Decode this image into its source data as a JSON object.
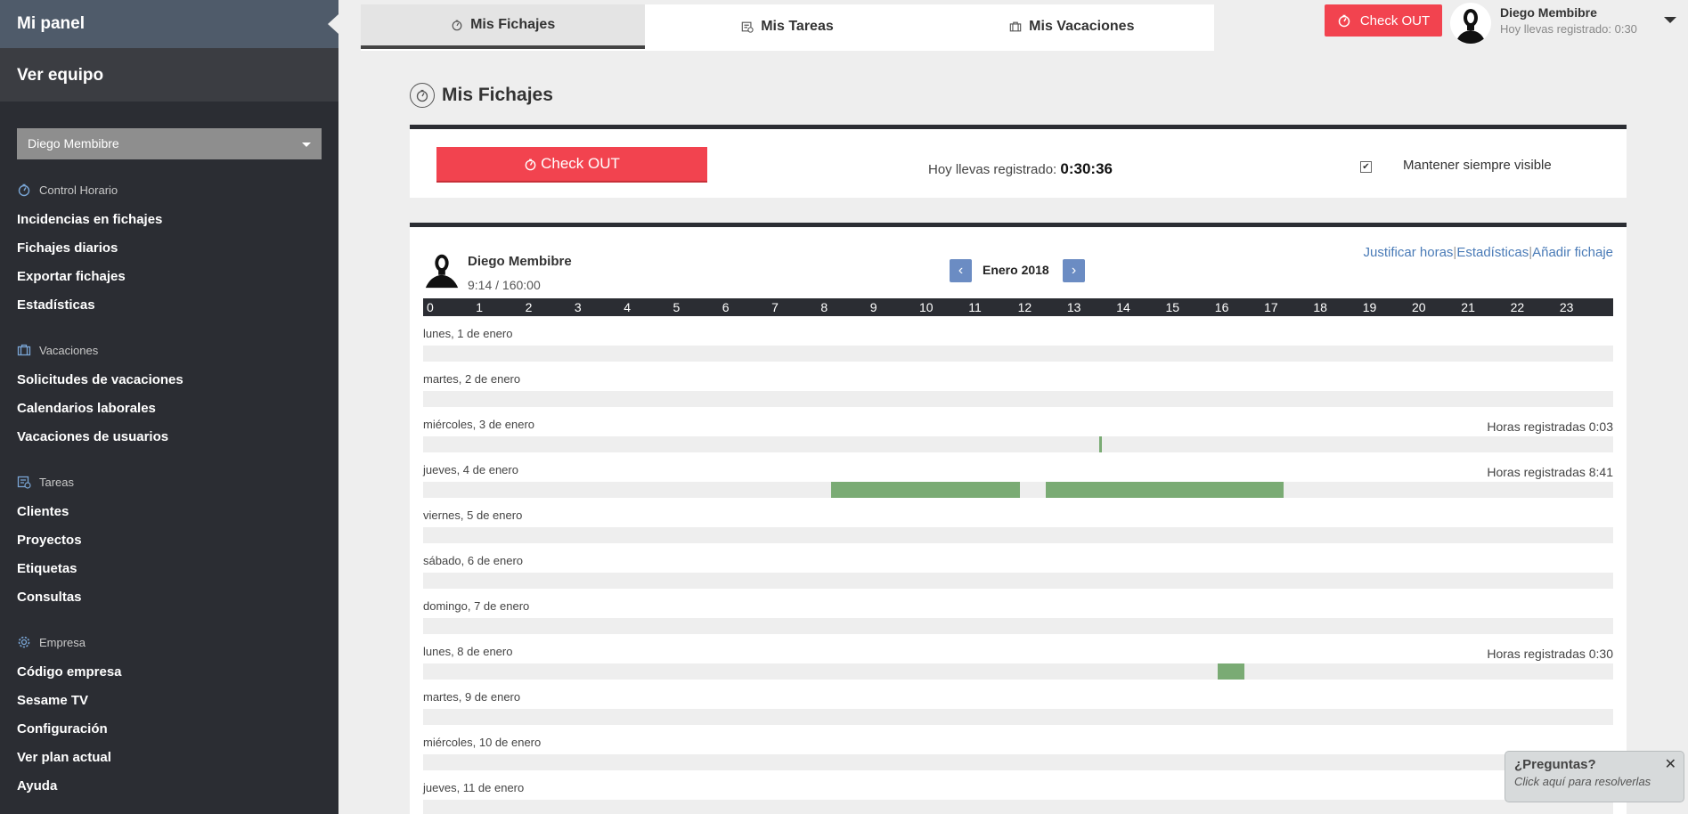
{
  "sidebar": {
    "title": "Mi panel",
    "team": "Ver equipo",
    "selected_user": "Diego Membibre",
    "sections": [
      {
        "title": "Control Horario",
        "icon": "stopwatch-icon",
        "items": [
          "Incidencias en fichajes",
          "Fichajes diarios",
          "Exportar fichajes",
          "Estadísticas"
        ]
      },
      {
        "title": "Vacaciones",
        "icon": "suitcase-icon",
        "items": [
          "Solicitudes de vacaciones",
          "Calendarios laborales",
          "Vacaciones de usuarios"
        ]
      },
      {
        "title": "Tareas",
        "icon": "tasks-icon",
        "items": [
          "Clientes",
          "Proyectos",
          "Etiquetas",
          "Consultas"
        ]
      },
      {
        "title": "Empresa",
        "icon": "gear-icon",
        "items": [
          "Código empresa",
          "Sesame TV",
          "Configuración",
          "Ver plan actual",
          "Ayuda"
        ]
      }
    ]
  },
  "tabs": [
    {
      "label": "Mis Fichajes",
      "icon": "stopwatch-icon",
      "active": true
    },
    {
      "label": "Mis Tareas",
      "icon": "tasks-icon",
      "active": false
    },
    {
      "label": "Mis Vacaciones",
      "icon": "suitcase-icon",
      "active": false
    }
  ],
  "topbar": {
    "checkout_label": "Check OUT",
    "user_name": "Diego Membibre",
    "user_status": "Hoy llevas registrado: 0:30"
  },
  "page": {
    "title": "Mis Fichajes"
  },
  "check_card": {
    "checkout_label": "Check OUT",
    "registered_label": "Hoy llevas registrado:",
    "registered_value": "0:30:36",
    "keep_visible_label": "Mantener siempre visible",
    "keep_visible_checked": true
  },
  "timeline": {
    "user_name": "Diego Membibre",
    "hours": "9:14 / 160:00",
    "month": "Enero 2018",
    "prev_symbol": "‹",
    "next_symbol": "›",
    "links": [
      "Justificar horas",
      "Estadísticas",
      "Añadir fichaje"
    ],
    "separator": "|",
    "hour_ticks": [
      "0",
      "1",
      "2",
      "3",
      "4",
      "5",
      "6",
      "7",
      "8",
      "9",
      "10",
      "11",
      "12",
      "13",
      "14",
      "15",
      "16",
      "17",
      "18",
      "19",
      "20",
      "21",
      "22",
      "23"
    ],
    "days": [
      {
        "label": "lunes, 1 de enero",
        "hours": "",
        "segments": []
      },
      {
        "label": "martes, 2 de enero",
        "hours": "",
        "segments": []
      },
      {
        "label": "miércoles, 3 de enero",
        "hours": "Horas registradas 0:03",
        "segments": [
          [
            13.58,
            13.63
          ]
        ]
      },
      {
        "label": "jueves, 4 de enero",
        "hours": "Horas registradas 8:41",
        "segments": [
          [
            8.13,
            11.97
          ],
          [
            12.5,
            17.32
          ]
        ]
      },
      {
        "label": "viernes, 5 de enero",
        "hours": "",
        "segments": []
      },
      {
        "label": "sábado, 6 de enero",
        "hours": "",
        "segments": []
      },
      {
        "label": "domingo, 7 de enero",
        "hours": "",
        "segments": []
      },
      {
        "label": "lunes, 8 de enero",
        "hours": "Horas registradas 0:30",
        "segments": [
          [
            15.98,
            16.52
          ]
        ]
      },
      {
        "label": "martes, 9 de enero",
        "hours": "",
        "segments": []
      },
      {
        "label": "miércoles, 10 de enero",
        "hours": "",
        "segments": []
      },
      {
        "label": "jueves, 11 de enero",
        "hours": "",
        "segments": []
      }
    ]
  },
  "help": {
    "title": "¿Preguntas?",
    "subtitle": "Click aquí para resolverlas",
    "close_symbol": "✕"
  },
  "colors": {
    "accent_red": "#f2434f",
    "sidebar_bg": "#2b2d33",
    "segment_green": "#7aab74",
    "link_blue": "#4a7bb7"
  }
}
